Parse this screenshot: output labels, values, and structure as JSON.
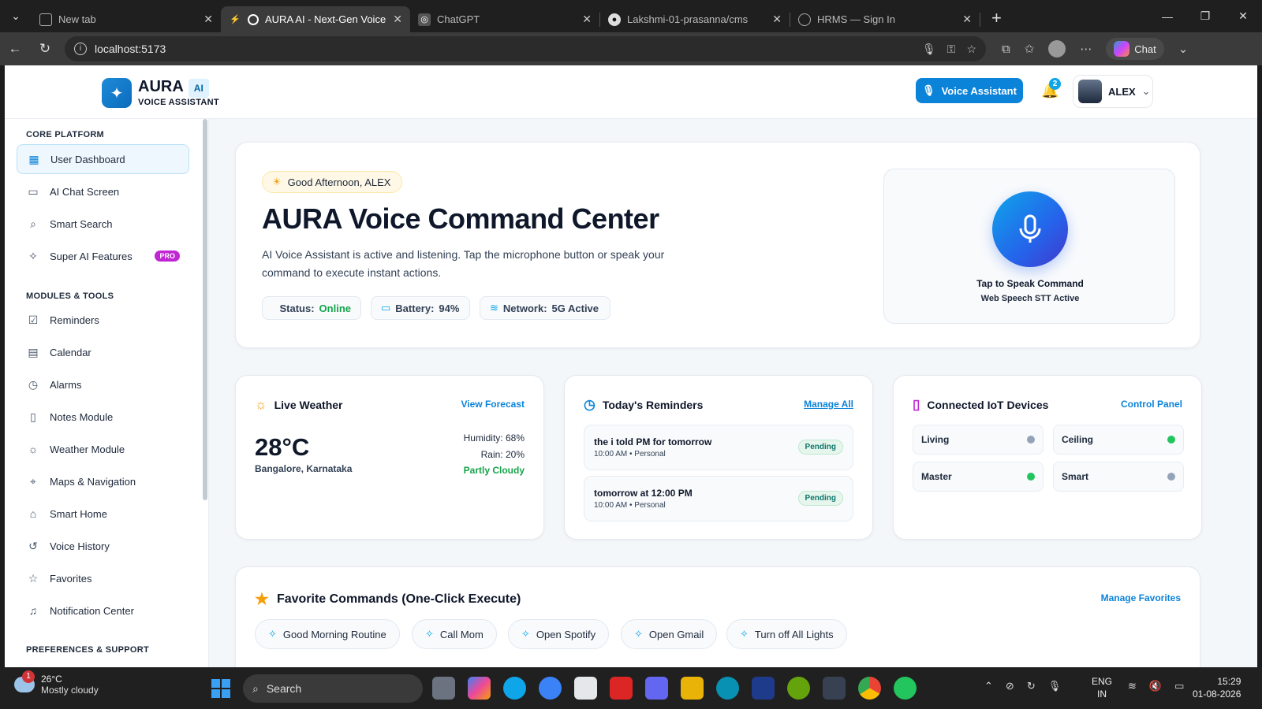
{
  "browser": {
    "tabs": [
      {
        "title": "New tab",
        "active": false
      },
      {
        "title": "AURA AI - Next-Gen Voice Ass",
        "active": true
      },
      {
        "title": "ChatGPT",
        "active": false
      },
      {
        "title": "Lakshmi-01-prasanna/cms",
        "active": false
      },
      {
        "title": "HRMS — Sign In",
        "active": false
      }
    ],
    "url": "localhost:5173",
    "chat_label": "Chat"
  },
  "header": {
    "logo_name": "AURA",
    "logo_badge": "AI",
    "logo_sub": "VOICE ASSISTANT",
    "voice_button": "Voice Assistant",
    "notification_count": "2",
    "user_name": "ALEX"
  },
  "sidebar": {
    "sections": [
      {
        "title": "CORE PLATFORM"
      },
      {
        "title": "MODULES & TOOLS"
      },
      {
        "title": "PREFERENCES & SUPPORT"
      }
    ],
    "core": [
      {
        "label": "User Dashboard",
        "icon": "grid-icon",
        "active": true
      },
      {
        "label": "AI Chat Screen",
        "icon": "chat-icon"
      },
      {
        "label": "Smart Search",
        "icon": "search-icon"
      },
      {
        "label": "Super AI Features",
        "icon": "sparkle-icon",
        "badge": "PRO"
      }
    ],
    "modules": [
      {
        "label": "Reminders",
        "icon": "checkbox-icon"
      },
      {
        "label": "Calendar",
        "icon": "calendar-icon"
      },
      {
        "label": "Alarms",
        "icon": "clock-icon"
      },
      {
        "label": "Notes Module",
        "icon": "note-icon"
      },
      {
        "label": "Weather Module",
        "icon": "sun-icon"
      },
      {
        "label": "Maps & Navigation",
        "icon": "pin-icon"
      },
      {
        "label": "Smart Home",
        "icon": "home-icon"
      },
      {
        "label": "Voice History",
        "icon": "history-icon"
      },
      {
        "label": "Favorites",
        "icon": "star-icon"
      },
      {
        "label": "Notification Center",
        "icon": "bell-icon"
      }
    ]
  },
  "hero": {
    "greeting": "Good Afternoon, ALEX",
    "title": "AURA Voice Command Center",
    "description": "AI Voice Assistant is active and listening. Tap the microphone button or speak your command to execute instant actions.",
    "status_label": "Status:",
    "status_value": "Online",
    "battery_label": "Battery:",
    "battery_value": "94%",
    "network_label": "Network:",
    "network_value": "5G Active",
    "mic_title": "Tap to Speak Command",
    "mic_sub": "Web Speech STT Active"
  },
  "weather": {
    "title": "Live Weather",
    "link": "View Forecast",
    "temp": "28°C",
    "location": "Bangalore, Karnataka",
    "humidity": "Humidity: 68%",
    "rain": "Rain: 20%",
    "condition": "Partly Cloudy"
  },
  "reminders": {
    "title": "Today's Reminders",
    "link": "Manage All",
    "items": [
      {
        "text": "the i told PM for tomorrow",
        "meta": "10:00 AM • Personal",
        "status": "Pending"
      },
      {
        "text": "tomorrow at 12:00 PM",
        "meta": "10:00 AM • Personal",
        "status": "Pending"
      }
    ]
  },
  "devices": {
    "title": "Connected IoT Devices",
    "link": "Control Panel",
    "items": [
      {
        "name": "Living",
        "on": false
      },
      {
        "name": "Ceiling",
        "on": true
      },
      {
        "name": "Master",
        "on": true
      },
      {
        "name": "Smart",
        "on": false
      }
    ],
    "on_color": "#22c55e",
    "off_color": "#94a3b8"
  },
  "favorites": {
    "title": "Favorite Commands (One-Click Execute)",
    "link": "Manage Favorites",
    "commands": [
      "Good Morning Routine",
      "Call Mom",
      "Open Spotify",
      "Open Gmail",
      "Turn off All Lights"
    ]
  },
  "taskbar": {
    "weather_temp": "26°C",
    "weather_desc": "Mostly cloudy",
    "weather_alert": "1",
    "search": "Search",
    "lang1": "ENG",
    "lang2": "IN",
    "time": "15:29",
    "date": "01-08-2026"
  },
  "colors": {
    "accent": "#0b83d9",
    "pro": "#c026d3",
    "online": "#16a34a"
  }
}
